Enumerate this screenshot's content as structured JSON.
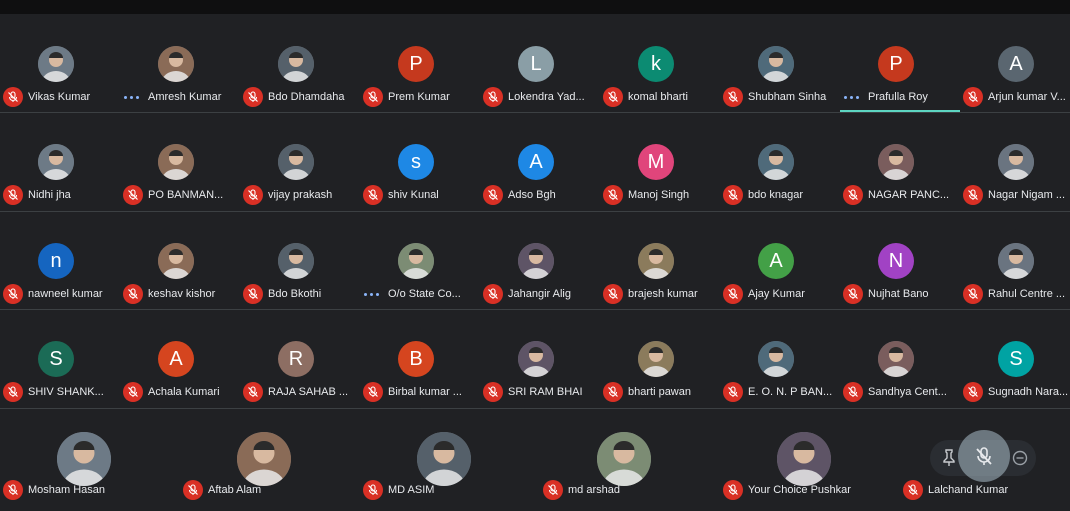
{
  "colors": {
    "background": "#202124",
    "muted": "#d93025",
    "speaking": "#5dd6c2"
  },
  "rows": [
    [
      {
        "name": "Vikas Kumar",
        "avatar": "photo",
        "status": "muted"
      },
      {
        "name": "Amresh Kumar",
        "avatar": "photo",
        "status": "speaking"
      },
      {
        "name": "Bdo Dhamdaha",
        "avatar": "photo",
        "status": "muted"
      },
      {
        "name": "Prem Kumar",
        "avatar": "letter",
        "letter": "P",
        "color": "#c5391e",
        "status": "muted"
      },
      {
        "name": "Lokendra Yad...",
        "avatar": "letter",
        "letter": "L",
        "color": "#8a9ea6",
        "status": "muted"
      },
      {
        "name": "komal bharti",
        "avatar": "letter",
        "letter": "k",
        "color": "#0c8b72",
        "status": "muted"
      },
      {
        "name": "Shubham Sinha",
        "avatar": "photo",
        "status": "muted"
      },
      {
        "name": "Prafulla Roy",
        "avatar": "letter",
        "letter": "P",
        "color": "#c5391e",
        "status": "speaking",
        "active": true
      },
      {
        "name": "Arjun kumar V...",
        "avatar": "letter",
        "letter": "A",
        "color": "#5a6670",
        "status": "muted"
      }
    ],
    [
      {
        "name": "Nidhi jha",
        "avatar": "photo",
        "status": "muted"
      },
      {
        "name": "PO BANMAN...",
        "avatar": "photo",
        "status": "muted"
      },
      {
        "name": "vijay prakash",
        "avatar": "photo",
        "status": "muted"
      },
      {
        "name": "shiv Kunal",
        "avatar": "letter",
        "letter": "s",
        "color": "#1e88e5",
        "status": "muted"
      },
      {
        "name": "Adso Bgh",
        "avatar": "letter",
        "letter": "A",
        "color": "#1e88e5",
        "status": "muted"
      },
      {
        "name": "Manoj Singh",
        "avatar": "letter",
        "letter": "M",
        "color": "#e0457b",
        "status": "muted"
      },
      {
        "name": "bdo knagar",
        "avatar": "photo",
        "status": "muted"
      },
      {
        "name": "NAGAR PANC...",
        "avatar": "photo",
        "status": "muted"
      },
      {
        "name": "Nagar Nigam ...",
        "avatar": "photo",
        "status": "muted"
      }
    ],
    [
      {
        "name": "nawneel kumar",
        "avatar": "letter",
        "letter": "n",
        "color": "#1565c0",
        "status": "muted"
      },
      {
        "name": "keshav kishor",
        "avatar": "photo",
        "status": "muted"
      },
      {
        "name": "Bdo Bkothi",
        "avatar": "photo",
        "status": "muted"
      },
      {
        "name": "O/o State Co...",
        "avatar": "photo",
        "status": "speaking"
      },
      {
        "name": "Jahangir Alig",
        "avatar": "photo",
        "status": "muted"
      },
      {
        "name": "brajesh kumar",
        "avatar": "photo",
        "status": "muted"
      },
      {
        "name": "Ajay Kumar",
        "avatar": "letter",
        "letter": "A",
        "color": "#43a047",
        "status": "muted"
      },
      {
        "name": "Nujhat Bano",
        "avatar": "letter",
        "letter": "N",
        "color": "#a142c4",
        "status": "muted"
      },
      {
        "name": "Rahul Centre ...",
        "avatar": "photo",
        "status": "muted"
      }
    ],
    [
      {
        "name": "SHIV SHANK...",
        "avatar": "letter",
        "letter": "S",
        "color": "#1b6b56",
        "status": "muted"
      },
      {
        "name": "Achala Kumari",
        "avatar": "letter",
        "letter": "A",
        "color": "#d5451f",
        "status": "muted"
      },
      {
        "name": "RAJA SAHAB ...",
        "avatar": "letter",
        "letter": "R",
        "color": "#8d6e63",
        "status": "muted"
      },
      {
        "name": "Birbal kumar ...",
        "avatar": "letter",
        "letter": "B",
        "color": "#d5451f",
        "status": "muted"
      },
      {
        "name": "SRI RAM BHAI",
        "avatar": "photo",
        "status": "muted"
      },
      {
        "name": "bharti pawan",
        "avatar": "photo",
        "status": "muted"
      },
      {
        "name": "E. O. N. P BAN...",
        "avatar": "photo",
        "status": "muted"
      },
      {
        "name": "Sandhya Cent...",
        "avatar": "photo",
        "status": "muted"
      },
      {
        "name": "Sugnadh Nara...",
        "avatar": "letter",
        "letter": "S",
        "color": "#00a3a3",
        "status": "muted"
      }
    ],
    [
      {
        "name": "Mosham Hasan",
        "avatar": "photo",
        "status": "muted"
      },
      {
        "name": "Aftab Alam",
        "avatar": "photo",
        "status": "muted"
      },
      {
        "name": "MD ASIM",
        "avatar": "photo",
        "status": "muted"
      },
      {
        "name": "md arshad",
        "avatar": "photo",
        "status": "muted"
      },
      {
        "name": "Your Choice Pushkar",
        "avatar": "photo",
        "status": "muted"
      },
      {
        "name": "Lalchand Kumar",
        "avatar": "none",
        "status": "muted"
      }
    ]
  ],
  "controls": {
    "pin_icon": "pin-icon",
    "mute_icon": "mic-off-icon",
    "remove_icon": "minus-circle-icon"
  }
}
